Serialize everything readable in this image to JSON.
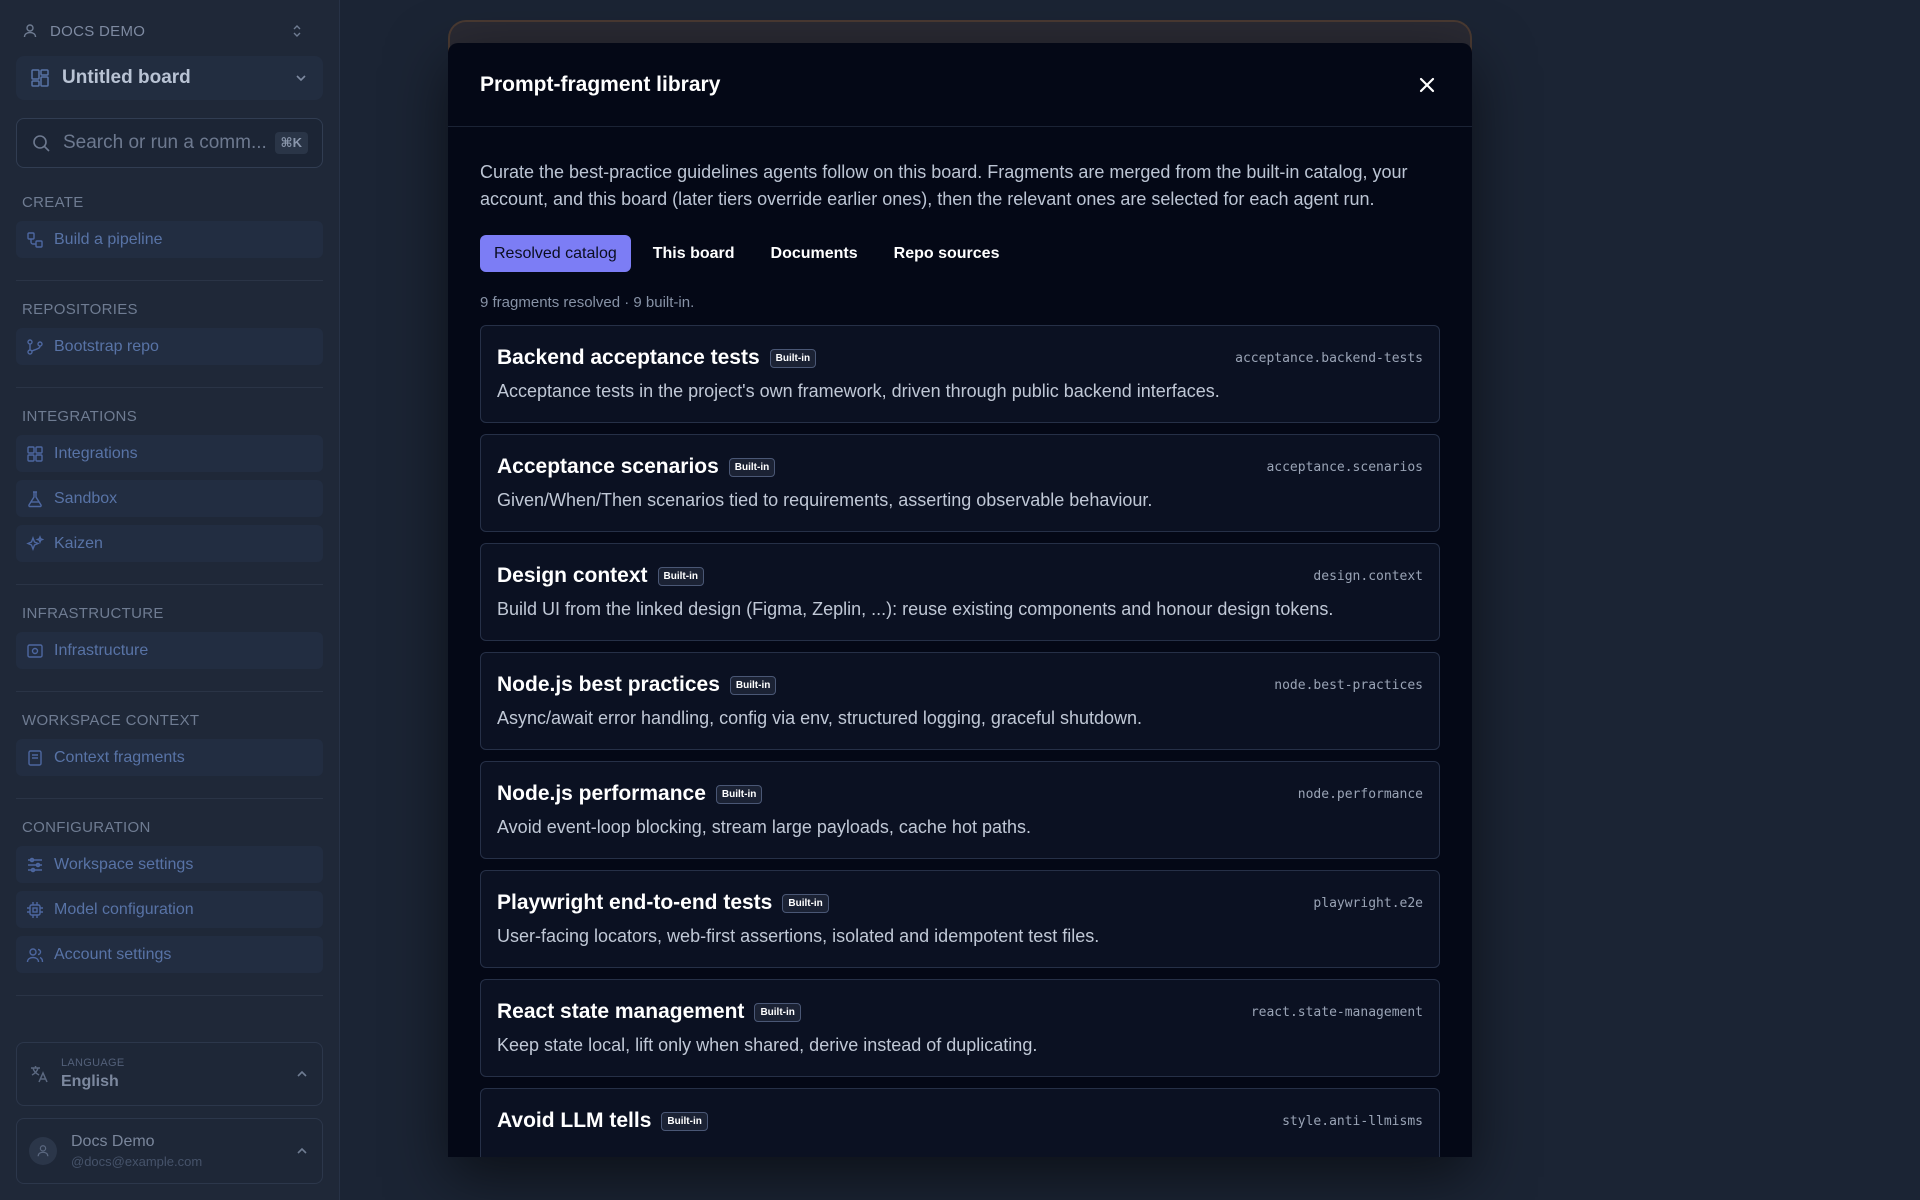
{
  "sidebar": {
    "workspace": "Docs demo",
    "board": "Untitled board",
    "search": {
      "placeholder": "Search or run a comm...",
      "shortcut": "⌘K"
    },
    "sections": [
      {
        "title": "Create",
        "items": [
          {
            "label": "Build a pipeline",
            "icon": "pipeline-icon"
          }
        ]
      },
      {
        "title": "Repositories",
        "items": [
          {
            "label": "Bootstrap repo",
            "icon": "git-branch-icon"
          }
        ]
      },
      {
        "title": "Integrations",
        "items": [
          {
            "label": "Integrations",
            "icon": "puzzle-grid-icon"
          },
          {
            "label": "Sandbox",
            "icon": "flask-icon"
          },
          {
            "label": "Kaizen",
            "icon": "sparkles-icon"
          }
        ]
      },
      {
        "title": "Infrastructure",
        "items": [
          {
            "label": "Infrastructure",
            "icon": "server-icon"
          }
        ]
      },
      {
        "title": "Workspace context",
        "items": [
          {
            "label": "Context fragments",
            "icon": "book-icon"
          }
        ]
      },
      {
        "title": "Configuration",
        "items": [
          {
            "label": "Workspace settings",
            "icon": "sliders-icon"
          },
          {
            "label": "Model configuration",
            "icon": "chip-icon"
          },
          {
            "label": "Account settings",
            "icon": "users-icon"
          }
        ]
      }
    ],
    "language": {
      "label": "Language",
      "value": "English"
    },
    "user": {
      "name": "Docs Demo",
      "email": "@docs@example.com"
    }
  },
  "modal": {
    "title": "Prompt-fragment library",
    "intro": "Curate the best-practice guidelines agents follow on this board. Fragments are merged from the built-in catalog, your account, and this board (later tiers override earlier ones), then the relevant ones are selected for each agent run.",
    "tabs": [
      {
        "label": "Resolved catalog",
        "active": true
      },
      {
        "label": "This board",
        "active": false
      },
      {
        "label": "Documents",
        "active": false
      },
      {
        "label": "Repo sources",
        "active": false
      }
    ],
    "count_line": "9 fragments resolved · 9 built-in.",
    "fragments": [
      {
        "title": "Backend acceptance tests",
        "badge": "Built-in",
        "key": "acceptance.backend-tests",
        "desc": "Acceptance tests in the project's own framework, driven through public backend interfaces."
      },
      {
        "title": "Acceptance scenarios",
        "badge": "Built-in",
        "key": "acceptance.scenarios",
        "desc": "Given/When/Then scenarios tied to requirements, asserting observable behaviour."
      },
      {
        "title": "Design context",
        "badge": "Built-in",
        "key": "design.context",
        "desc": "Build UI from the linked design (Figma, Zeplin, ...): reuse existing components and honour design tokens."
      },
      {
        "title": "Node.js best practices",
        "badge": "Built-in",
        "key": "node.best-practices",
        "desc": "Async/await error handling, config via env, structured logging, graceful shutdown."
      },
      {
        "title": "Node.js performance",
        "badge": "Built-in",
        "key": "node.performance",
        "desc": "Avoid event-loop blocking, stream large payloads, cache hot paths."
      },
      {
        "title": "Playwright end-to-end tests",
        "badge": "Built-in",
        "key": "playwright.e2e",
        "desc": "User-facing locators, web-first assertions, isolated and idempotent test files."
      },
      {
        "title": "React state management",
        "badge": "Built-in",
        "key": "react.state-management",
        "desc": "Keep state local, lift only when shared, derive instead of duplicating."
      },
      {
        "title": "Avoid LLM tells",
        "badge": "Built-in",
        "key": "style.anti-llmisms",
        "desc": ""
      }
    ]
  },
  "colors": {
    "accent": "#7c7df5",
    "modal_bg": "#040816",
    "card_bg": "#0b1122",
    "page_bg": "#1b2434"
  }
}
